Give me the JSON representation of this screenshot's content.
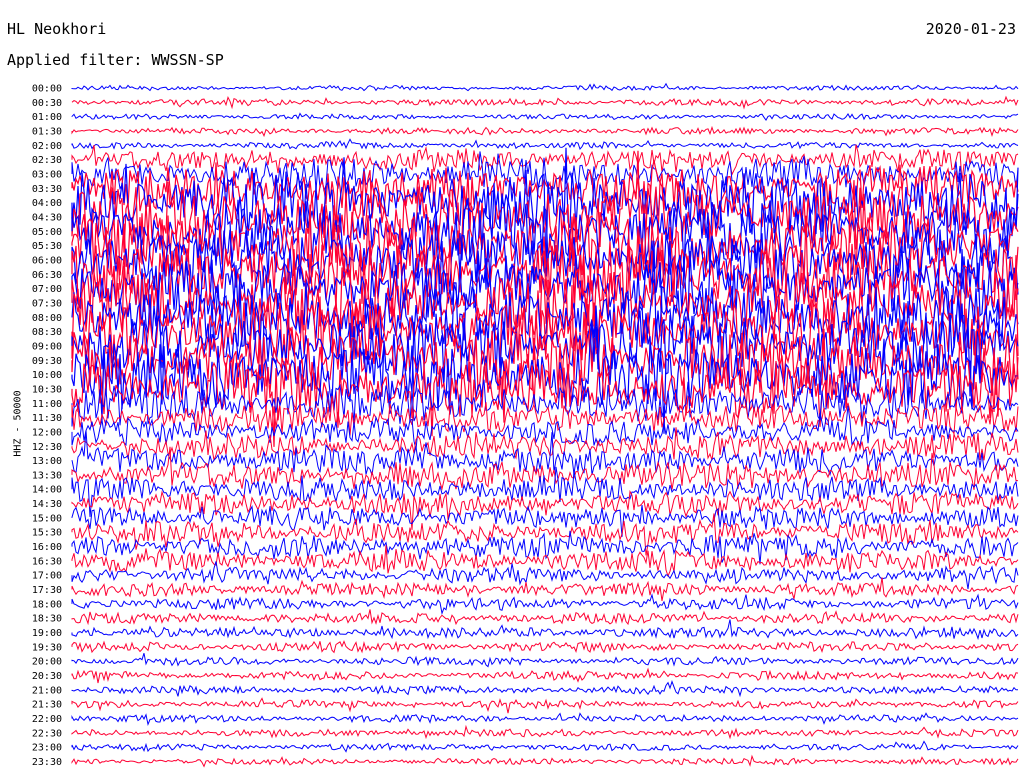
{
  "header": {
    "station": "HL Neokhori",
    "date": "2020-01-23",
    "filter": "Applied filter: WWSSN-SP"
  },
  "chart_data": {
    "type": "line",
    "title": "HL Neokhori",
    "channel_label": "HHZ - 50000",
    "row_labels": [
      "00:00",
      "00:30",
      "01:00",
      "01:30",
      "02:00",
      "02:30",
      "03:00",
      "03:30",
      "04:00",
      "04:30",
      "05:00",
      "05:30",
      "06:00",
      "06:30",
      "07:00",
      "07:30",
      "08:00",
      "08:30",
      "09:00",
      "09:30",
      "10:00",
      "10:30",
      "11:00",
      "11:30",
      "12:00",
      "12:30",
      "13:00",
      "13:30",
      "14:00",
      "14:30",
      "15:00",
      "15:30",
      "16:00",
      "16:30",
      "17:00",
      "17:30",
      "18:00",
      "18:30",
      "19:00",
      "19:30",
      "20:00",
      "20:30",
      "21:00",
      "21:30",
      "22:00",
      "22:30",
      "23:00",
      "23:30"
    ],
    "trace_colors": [
      "#0000ff",
      "#ff0033"
    ],
    "activity": [
      0.02,
      0.05,
      0.03,
      0.05,
      0.05,
      0.3,
      0.45,
      0.7,
      0.95,
      1.0,
      1.0,
      1.0,
      1.0,
      1.0,
      1.0,
      1.0,
      1.0,
      1.0,
      1.0,
      1.0,
      1.0,
      0.9,
      0.55,
      0.4,
      0.35,
      0.35,
      0.38,
      0.38,
      0.35,
      0.32,
      0.3,
      0.3,
      0.32,
      0.28,
      0.2,
      0.16,
      0.14,
      0.12,
      0.12,
      0.1,
      0.08,
      0.08,
      0.07,
      0.07,
      0.06,
      0.06,
      0.05,
      0.05
    ],
    "grid": false
  }
}
